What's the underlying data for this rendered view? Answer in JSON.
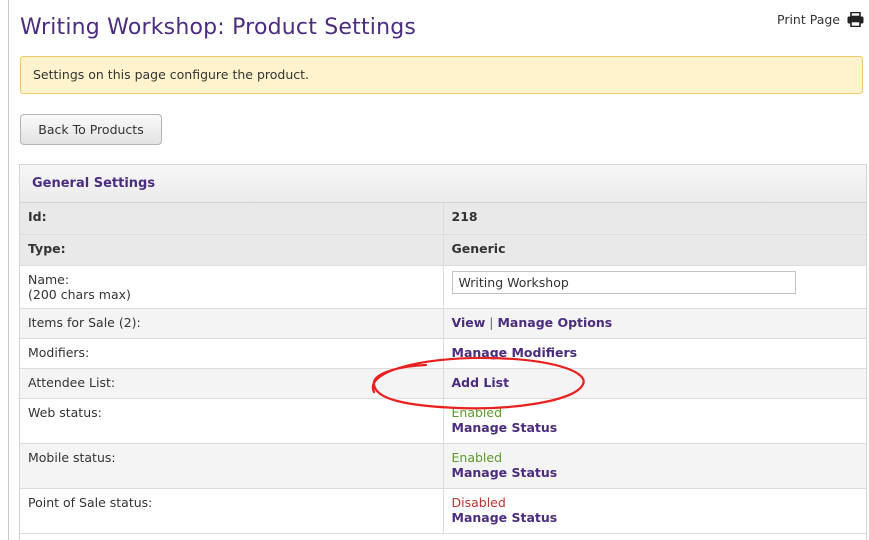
{
  "page": {
    "title": "Writing Workshop: Product Settings",
    "print_label": "Print Page",
    "print_icon": "printer-icon"
  },
  "notice": "Settings on this page configure the product.",
  "back_button": "Back To Products",
  "panel": {
    "heading": "General Settings",
    "id": {
      "label": "Id:",
      "value": "218"
    },
    "type": {
      "label": "Type:",
      "value": "Generic"
    },
    "name": {
      "label": "Name:",
      "hint": "(200 chars max)",
      "value": "Writing Workshop"
    },
    "items": {
      "label": "Items for Sale (2):",
      "view_link": "View",
      "separator": "|",
      "manage_options_link": "Manage Options"
    },
    "modifiers": {
      "label": "Modifiers:",
      "link": "Manage Modifiers"
    },
    "attendee_list": {
      "label": "Attendee List:",
      "link": "Add List"
    },
    "web_status": {
      "label": "Web status:",
      "status": "Enabled",
      "link": "Manage Status"
    },
    "mobile_status": {
      "label": "Mobile status:",
      "status": "Enabled",
      "link": "Manage Status"
    },
    "pos_status": {
      "label": "Point of Sale status:",
      "status": "Disabled",
      "link": "Manage Status"
    }
  },
  "colors": {
    "brand_purple": "#4b2c7e",
    "enabled_green": "#5b9a2a",
    "disabled_red": "#b8362f",
    "annotation_red": "#e8201e",
    "notice_bg": "#fff3cd"
  }
}
